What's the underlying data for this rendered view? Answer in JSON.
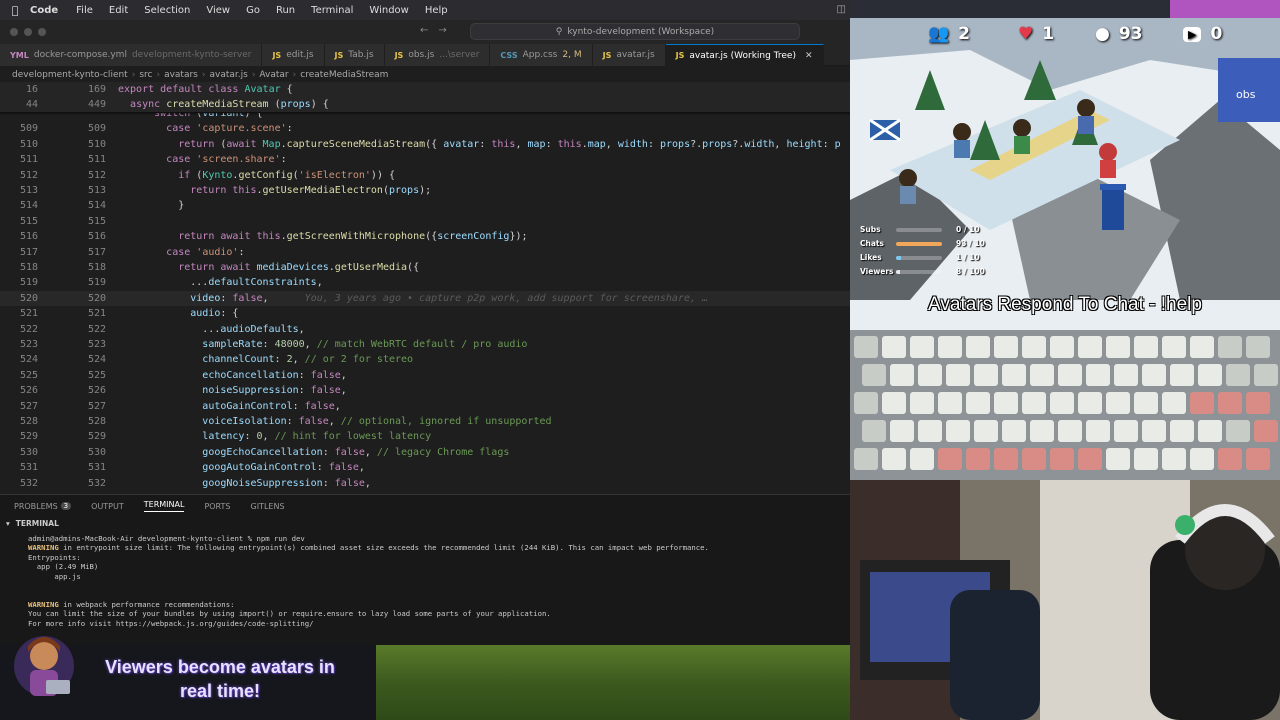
{
  "menubar": {
    "app": "Code",
    "items": [
      "File",
      "Edit",
      "Selection",
      "View",
      "Go",
      "Run",
      "Terminal",
      "Window",
      "Help"
    ]
  },
  "window": {
    "search": "kynto-development (Workspace)"
  },
  "tabs": [
    {
      "icon": "YML",
      "label": "docker-compose.yml",
      "hint": "development-kynto-server",
      "mod": ""
    },
    {
      "icon": "JS",
      "label": "edit.js",
      "hint": "",
      "mod": ""
    },
    {
      "icon": "JS",
      "label": "Tab.js",
      "hint": "",
      "mod": ""
    },
    {
      "icon": "JS",
      "label": "obs.js",
      "hint": "...\\server",
      "mod": ""
    },
    {
      "icon": "CSS",
      "label": "App.css",
      "hint": "",
      "mod": "2, M"
    },
    {
      "icon": "JS",
      "label": "avatar.js",
      "hint": "",
      "mod": ""
    },
    {
      "icon": "JS",
      "label": "avatar.js (Working Tree)",
      "hint": "",
      "mod": "",
      "active": true
    }
  ],
  "breadcrumb": [
    "development-kynto-client",
    "src",
    "avatars",
    "avatar.js",
    "Avatar",
    "createMediaStream"
  ],
  "sticky": [
    {
      "ln1": "16",
      "ln2": "169",
      "code": "export default class Avatar {"
    },
    {
      "ln1": "44",
      "ln2": "449",
      "code": "  async createMediaStream (props) {"
    }
  ],
  "code_lines": [
    {
      "ln1": "",
      "ln2": "",
      "code": "      switch (variant) {"
    },
    {
      "ln1": "509",
      "ln2": "509",
      "code": "        case 'capture.scene':"
    },
    {
      "ln1": "510",
      "ln2": "510",
      "code": "          return (await Map.captureSceneMediaStream({ avatar: this, map: this.map, width: props?.props?.width, height: p"
    },
    {
      "ln1": "511",
      "ln2": "511",
      "code": "        case 'screen.share':"
    },
    {
      "ln1": "512",
      "ln2": "512",
      "code": "          if (Kynto.getConfig('isElectron')) {"
    },
    {
      "ln1": "513",
      "ln2": "513",
      "code": "            return this.getUserMediaElectron(props);"
    },
    {
      "ln1": "514",
      "ln2": "514",
      "code": "          }"
    },
    {
      "ln1": "515",
      "ln2": "515",
      "code": ""
    },
    {
      "ln1": "516",
      "ln2": "516",
      "code": "          return await this.getScreenWithMicrophone({screenConfig});"
    },
    {
      "ln1": "517",
      "ln2": "517",
      "code": "        case 'audio':"
    },
    {
      "ln1": "518",
      "ln2": "518",
      "code": "          return await mediaDevices.getUserMedia({"
    },
    {
      "ln1": "519",
      "ln2": "519",
      "code": "            ...defaultConstraints,"
    },
    {
      "ln1": "520",
      "ln2": "520",
      "code": "            video: false,",
      "blame": "      You, 3 years ago • capture p2p work, add support for screenshare, …"
    },
    {
      "ln1": "521",
      "ln2": "521",
      "code": "            audio: {"
    },
    {
      "ln1": "522",
      "ln2": "522",
      "code": "              ...audioDefaults,"
    },
    {
      "ln1": "523",
      "ln2": "523",
      "code": "              sampleRate: 48000, // match WebRTC default / pro audio"
    },
    {
      "ln1": "524",
      "ln2": "524",
      "code": "              channelCount: 2, // or 2 for stereo"
    },
    {
      "ln1": "525",
      "ln2": "525",
      "code": "              echoCancellation: false,"
    },
    {
      "ln1": "526",
      "ln2": "526",
      "code": "              noiseSuppression: false,"
    },
    {
      "ln1": "527",
      "ln2": "527",
      "code": "              autoGainControl: false,"
    },
    {
      "ln1": "528",
      "ln2": "528",
      "code": "              voiceIsolation: false, // optional, ignored if unsupported"
    },
    {
      "ln1": "529",
      "ln2": "529",
      "code": "              latency: 0, // hint for lowest latency"
    },
    {
      "ln1": "530",
      "ln2": "530",
      "code": "              googEchoCancellation: false, // legacy Chrome flags"
    },
    {
      "ln1": "531",
      "ln2": "531",
      "code": "              googAutoGainControl: false,"
    },
    {
      "ln1": "532",
      "ln2": "532",
      "code": "              googNoiseSuppression: false,"
    }
  ],
  "panel": {
    "tabs": [
      {
        "label": "PROBLEMS",
        "badge": "3"
      },
      {
        "label": "OUTPUT",
        "badge": ""
      },
      {
        "label": "TERMINAL",
        "badge": "",
        "active": true
      },
      {
        "label": "PORTS",
        "badge": ""
      },
      {
        "label": "GITLENS",
        "badge": ""
      }
    ],
    "terminal_title": "TERMINAL",
    "terminal_lines": [
      "admin@admins-MacBook-Air development-kynto-client % npm run dev",
      "WARNING in entrypoint size limit: The following entrypoint(s) combined asset size exceeds the recommended limit (244 KiB). This can impact web performance.",
      "Entrypoints:",
      "  app (2.49 MiB)",
      "      app.js",
      "",
      "",
      "WARNING in webpack performance recommendations:",
      "You can limit the size of your bundles by using import() or require.ensure to lazy load some parts of your application.",
      "For more info visit https://webpack.js.org/guides/code-splitting/"
    ]
  },
  "banner": {
    "line1": "Viewers become avatars in",
    "line2": "real time!"
  },
  "stream": {
    "stats": [
      {
        "icon": "viewers-icon",
        "value": "2"
      },
      {
        "icon": "heart-icon",
        "value": "1"
      },
      {
        "icon": "chat-icon",
        "value": "93"
      },
      {
        "icon": "youtube-icon",
        "value": "0"
      }
    ],
    "obs_label": "obs",
    "meters": [
      {
        "label": "Subs",
        "value": "0 / 10",
        "fraction": 0.0,
        "color": "#e6e6e6"
      },
      {
        "label": "Chats",
        "value": "93 / 10",
        "fraction": 1.0,
        "color": "#f2a65a"
      },
      {
        "label": "Likes",
        "value": "1 / 10",
        "fraction": 0.1,
        "color": "#7ec8f0"
      },
      {
        "label": "Viewers",
        "value": "8 / 100",
        "fraction": 0.08,
        "color": "#e6e6e6"
      }
    ],
    "subtitle": "Avatars Respond To Chat - !help"
  },
  "colors": {
    "accent": "#007acc",
    "keyword": "#c586c0",
    "string": "#ce9178",
    "comment": "#6a9955",
    "function": "#dcdcaa",
    "variable": "#9cdcfe",
    "number": "#b5cea8"
  }
}
